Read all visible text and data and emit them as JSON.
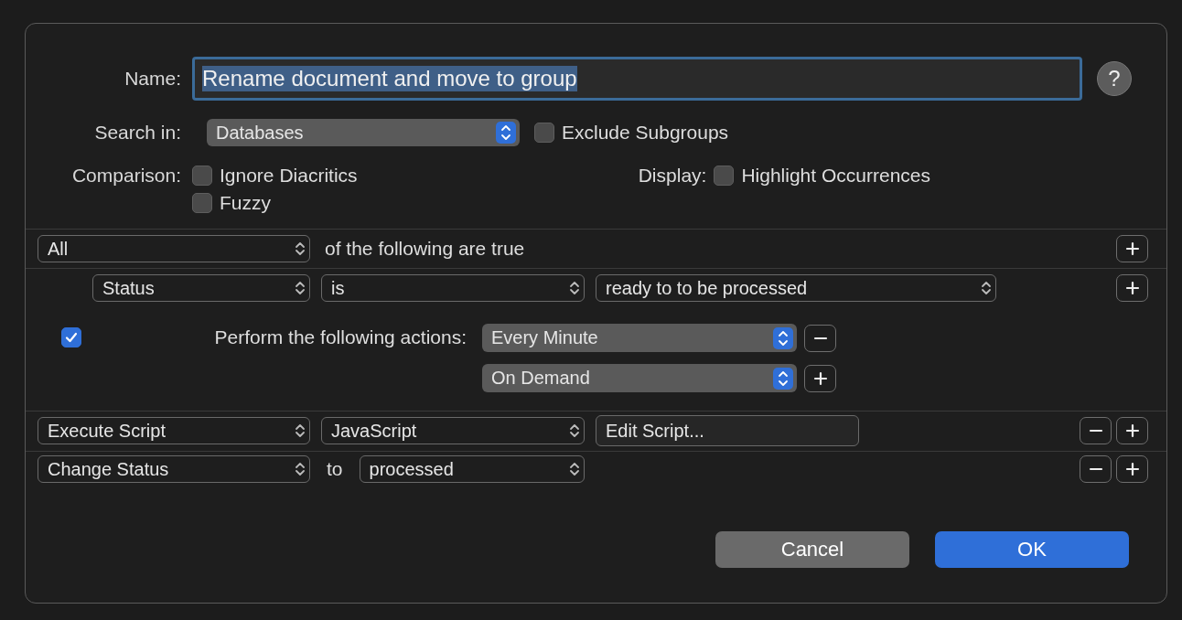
{
  "name": {
    "label": "Name:",
    "value": "Rename document and move to group",
    "selected": true
  },
  "help_button": "?",
  "search_in": {
    "label": "Search in:",
    "value": "Databases"
  },
  "exclude_subgroups": {
    "label": "Exclude Subgroups",
    "checked": false
  },
  "comparison": {
    "label": "Comparison:",
    "options": [
      {
        "label": "Ignore Diacritics",
        "checked": false
      },
      {
        "label": "Fuzzy",
        "checked": false
      }
    ]
  },
  "display": {
    "label": "Display:",
    "options": [
      {
        "label": "Highlight Occurrences",
        "checked": false
      }
    ]
  },
  "match": {
    "value": "All",
    "text": "of the following are true",
    "buttons": [
      {
        "kind": "add"
      }
    ]
  },
  "conditions": [
    {
      "field": "Status",
      "operator": "is",
      "value": "ready to to be processed",
      "buttons": [
        {
          "kind": "add"
        }
      ]
    }
  ],
  "perform": {
    "checked": true,
    "label": "Perform the following actions:",
    "triggers": [
      {
        "value": "Every Minute",
        "button": {
          "kind": "remove"
        }
      },
      {
        "value": "On Demand",
        "button": {
          "kind": "add"
        }
      }
    ]
  },
  "actions": [
    {
      "kind": "script",
      "first": "Execute Script",
      "second": "JavaScript",
      "field": "Edit Script...",
      "buttons": [
        {
          "kind": "remove"
        },
        {
          "kind": "add"
        }
      ]
    },
    {
      "kind": "status",
      "first": "Change Status",
      "joiner": "to",
      "second": "processed",
      "buttons": [
        {
          "kind": "remove"
        },
        {
          "kind": "add"
        }
      ]
    }
  ],
  "footer_buttons": [
    {
      "label": "Cancel",
      "kind": "secondary"
    },
    {
      "label": "OK",
      "kind": "primary"
    }
  ]
}
